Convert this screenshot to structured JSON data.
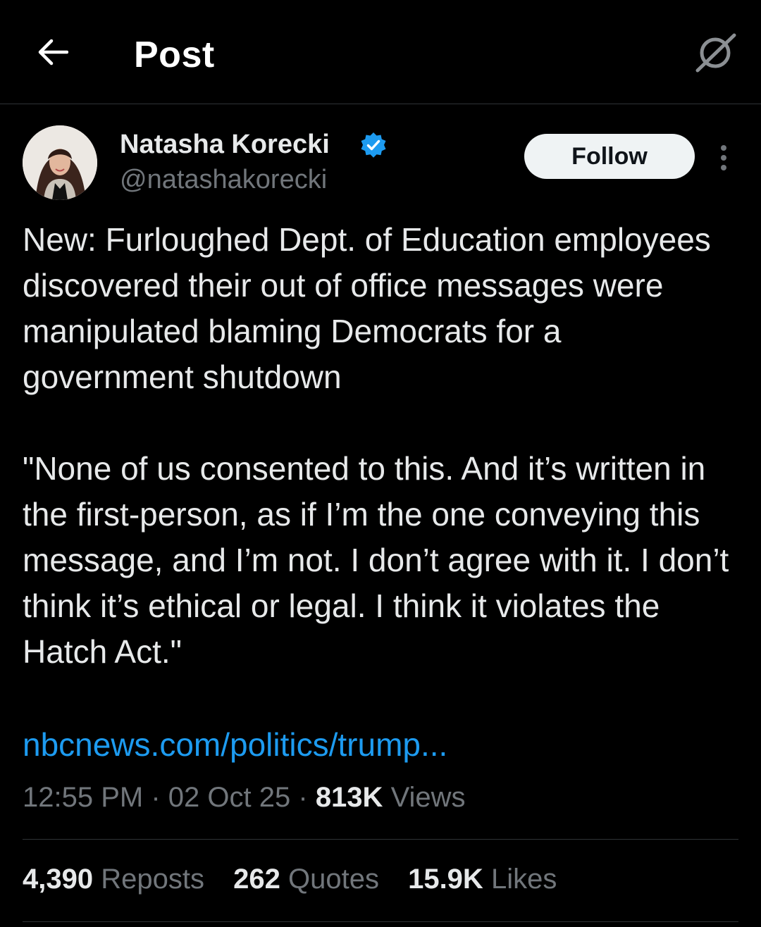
{
  "header": {
    "title": "Post",
    "back_icon": "arrow-left-icon",
    "grok_icon": "grok-slash-icon"
  },
  "author": {
    "display_name": "Natasha Korecki",
    "handle": "@natashakorecki",
    "verified": true,
    "verified_color": "#1d9bf0",
    "follow_label": "Follow",
    "more_icon": "more-vertical-icon"
  },
  "tweet": {
    "paragraphs": [
      "New: Furloughed Dept. of Education employees discovered their out of office messages were manipulated blaming Democrats for a government shutdown",
      "\"None of us consented to this. And it’s written in the first-person, as if I’m the one conveying this message, and I’m not. I don’t agree with it. I don’t think it’s ethical or legal. I think it violates the Hatch Act.\""
    ],
    "link": "nbcnews.com/politics/trump..."
  },
  "meta": {
    "time": "12:55 PM",
    "sep1": "·",
    "date": "02 Oct 25",
    "sep2": "·",
    "views_count": "813K",
    "views_label": "Views"
  },
  "stats": {
    "reposts_count": "4,390",
    "reposts_label": "Reposts",
    "quotes_count": "262",
    "quotes_label": "Quotes",
    "likes_count": "15.9K",
    "likes_label": "Likes"
  },
  "colors": {
    "background": "#000000",
    "text": "#e7e9ea",
    "secondary": "#71767b",
    "link": "#1d9bf0",
    "divider": "#2f3336"
  }
}
